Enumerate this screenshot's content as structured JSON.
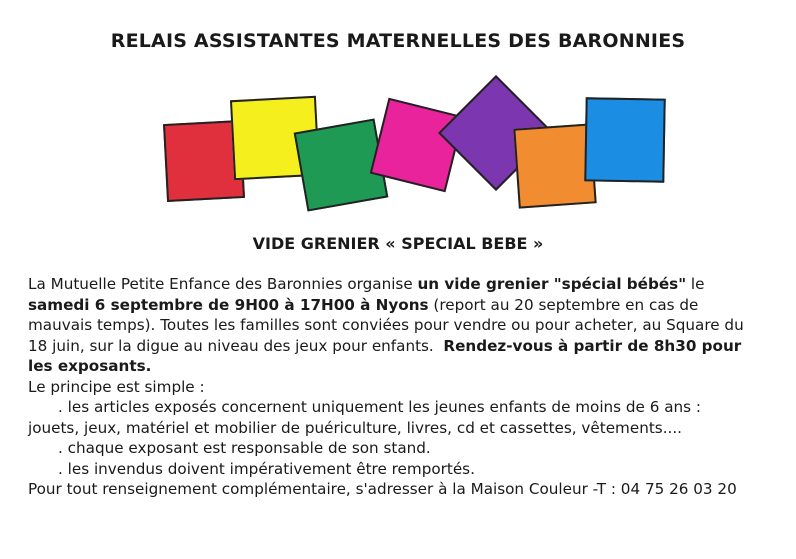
{
  "title": "RELAIS ASSISTANTES MATERNELLES DES BARONNIES",
  "squares": [
    {
      "name": "red",
      "color": "#e0303e"
    },
    {
      "name": "yellow",
      "color": "#f5ef1e"
    },
    {
      "name": "green",
      "color": "#1e9a55"
    },
    {
      "name": "pink",
      "color": "#e8239b"
    },
    {
      "name": "purple",
      "color": "#7c36b0"
    },
    {
      "name": "orange",
      "color": "#f28c30"
    },
    {
      "name": "blue",
      "color": "#1b8de2"
    }
  ],
  "subtitle": "VIDE GRENIER « SPECIAL BEBE »",
  "para1": {
    "a": "La Mutuelle Petite Enfance des Baronnies organise ",
    "b": "un vide grenier \"spécial bébés\"",
    "c": " le",
    "d": "samedi 6 septembre de 9H00 à 17H00 à Nyons",
    "e": " (report au 20 septembre en cas de",
    "f": "mauvais temps). Toutes les familles sont conviées pour vendre ou pour acheter, au Square du",
    "g": "18 juin, sur la digue au niveau des jeux pour enfants.  ",
    "h": "Rendez-vous à partir de 8h30 pour",
    "i": "les exposants."
  },
  "principe": "Le principe est simple :",
  "rule1a": ". les articles exposés concernent uniquement les jeunes enfants de moins de 6 ans :",
  "rule1b": "jouets, jeux, matériel et mobilier de puériculture, livres, cd et cassettes, vêtements....",
  "rule2": ". chaque exposant est responsable de son stand.",
  "rule3": ". les invendus doivent impérativement être remportés.",
  "contact": "Pour tout renseignement complémentaire, s'adresser à la Maison Couleur -T : 04 75 26 03 20"
}
